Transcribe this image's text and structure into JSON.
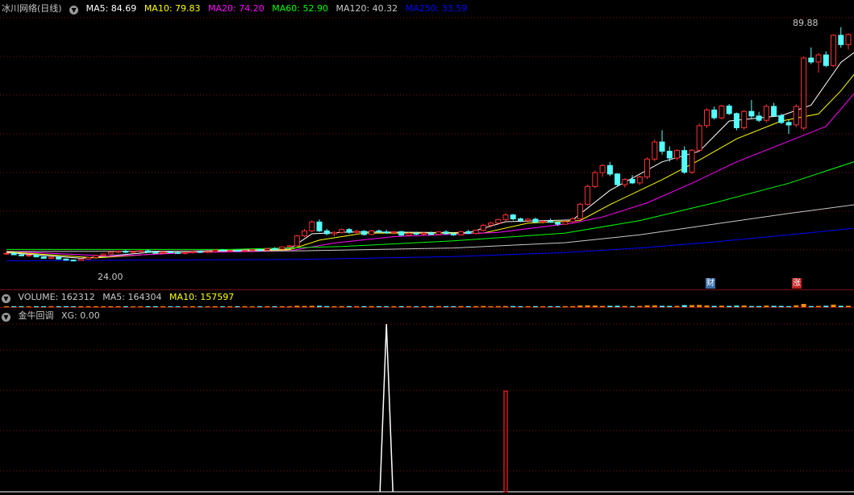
{
  "header": {
    "stock_title": "冰川网络(日线)",
    "ma_legend": [
      {
        "label": "MA5: 84.69",
        "color": "#ffffff"
      },
      {
        "label": "MA10: 79.83",
        "color": "#ffff00"
      },
      {
        "label": "MA20: 74.20",
        "color": "#ff00ff"
      },
      {
        "label": "MA60: 52.90",
        "color": "#00ff00"
      },
      {
        "label": "MA120: 40.32",
        "color": "#c8c8c8"
      },
      {
        "label": "MA250: 33.59",
        "color": "#0000ff"
      }
    ],
    "high_marker": "89.88",
    "low_marker": "24.00",
    "event_markers": [
      {
        "label": "财",
        "color": "#3a6ea5"
      },
      {
        "label": "涨",
        "color": "#c02020"
      }
    ]
  },
  "volume": {
    "title": "VOLUME: 162312",
    "ma5": "MA5: 164304",
    "ma10": "MA10: 157597"
  },
  "indicator": {
    "title": "金牛回调",
    "xg": "XG: 0.00"
  },
  "colors": {
    "up": "#ff3232",
    "down": "#54ffff",
    "grid": "#7a0f0f",
    "text": "#c8c8c8"
  },
  "chart_data": {
    "type": "candlestick",
    "price_range": [
      20,
      93
    ],
    "candles": [
      [
        26.2,
        26.5,
        25.9,
        26.3
      ],
      [
        26.3,
        26.4,
        25.8,
        25.9
      ],
      [
        25.9,
        26.1,
        25.5,
        25.6
      ],
      [
        25.6,
        25.9,
        25.3,
        25.8
      ],
      [
        25.8,
        25.9,
        25.2,
        25.3
      ],
      [
        25.3,
        25.5,
        24.8,
        24.9
      ],
      [
        24.9,
        25.3,
        24.7,
        25.2
      ],
      [
        25.2,
        25.3,
        24.6,
        24.7
      ],
      [
        24.7,
        24.9,
        24.2,
        24.4
      ],
      [
        24.4,
        24.6,
        24.0,
        24.3
      ],
      [
        24.3,
        24.8,
        24.2,
        24.7
      ],
      [
        24.7,
        25.2,
        24.6,
        25.1
      ],
      [
        25.1,
        25.9,
        25.0,
        25.7
      ],
      [
        25.7,
        26.3,
        25.5,
        26.1
      ],
      [
        26.1,
        26.8,
        25.9,
        26.6
      ],
      [
        26.6,
        27.1,
        26.2,
        26.9
      ],
      [
        26.9,
        27.3,
        26.4,
        26.6
      ],
      [
        26.6,
        27.0,
        26.3,
        26.8
      ],
      [
        26.8,
        27.2,
        26.5,
        27.0
      ],
      [
        27.0,
        27.3,
        26.5,
        26.6
      ],
      [
        26.6,
        26.9,
        26.2,
        26.4
      ],
      [
        26.4,
        26.8,
        26.1,
        26.7
      ],
      [
        26.7,
        27.0,
        26.3,
        26.5
      ],
      [
        26.5,
        26.8,
        26.1,
        26.3
      ],
      [
        26.3,
        26.6,
        26.0,
        26.5
      ],
      [
        26.5,
        26.9,
        26.2,
        26.8
      ],
      [
        26.8,
        27.1,
        26.4,
        26.6
      ],
      [
        26.6,
        26.9,
        26.3,
        26.8
      ],
      [
        26.8,
        27.4,
        26.6,
        27.2
      ],
      [
        27.2,
        27.5,
        26.8,
        27.0
      ],
      [
        27.0,
        27.3,
        26.7,
        27.1
      ],
      [
        27.1,
        27.4,
        26.8,
        26.9
      ],
      [
        26.9,
        27.2,
        26.7,
        27.1
      ],
      [
        27.1,
        27.5,
        26.9,
        27.3
      ],
      [
        27.3,
        27.6,
        27.0,
        27.2
      ],
      [
        27.2,
        27.8,
        27.0,
        27.6
      ],
      [
        27.6,
        28.0,
        27.3,
        27.5
      ],
      [
        27.5,
        28.3,
        27.4,
        28.1
      ],
      [
        28.1,
        28.6,
        27.9,
        28.4
      ],
      [
        28.4,
        31.5,
        28.2,
        31.2
      ],
      [
        31.2,
        33.2,
        30.8,
        32.6
      ],
      [
        32.6,
        35.6,
        32.2,
        35.1
      ],
      [
        35.1,
        35.8,
        32.3,
        32.6
      ],
      [
        32.6,
        33.2,
        31.4,
        31.8
      ],
      [
        31.8,
        32.5,
        31.1,
        32.2
      ],
      [
        32.2,
        33.3,
        31.9,
        33.0
      ],
      [
        33.0,
        33.4,
        31.8,
        32.2
      ],
      [
        32.2,
        32.9,
        31.6,
        32.5
      ],
      [
        32.5,
        32.8,
        31.3,
        31.6
      ],
      [
        31.6,
        32.9,
        31.4,
        32.6
      ],
      [
        32.6,
        33.0,
        31.9,
        32.3
      ],
      [
        32.3,
        32.9,
        31.8,
        32.1
      ],
      [
        32.1,
        32.6,
        31.6,
        32.4
      ],
      [
        32.4,
        32.6,
        31.2,
        31.4
      ],
      [
        31.4,
        32.2,
        31.1,
        31.9
      ],
      [
        31.9,
        32.4,
        31.4,
        31.7
      ],
      [
        31.7,
        32.3,
        31.2,
        32.0
      ],
      [
        32.0,
        32.4,
        31.4,
        31.6
      ],
      [
        31.6,
        32.6,
        31.4,
        32.3
      ],
      [
        32.3,
        32.8,
        31.6,
        31.8
      ],
      [
        31.8,
        32.2,
        31.2,
        31.5
      ],
      [
        31.5,
        32.6,
        31.3,
        32.4
      ],
      [
        32.4,
        32.9,
        31.7,
        31.9
      ],
      [
        31.9,
        33.0,
        31.6,
        32.8
      ],
      [
        32.8,
        34.6,
        32.5,
        34.2
      ],
      [
        34.2,
        35.2,
        33.6,
        34.8
      ],
      [
        34.8,
        36.1,
        34.3,
        35.8
      ],
      [
        35.8,
        37.6,
        35.2,
        37.1
      ],
      [
        37.1,
        37.4,
        35.6,
        36.0
      ],
      [
        36.0,
        36.3,
        35.1,
        35.5
      ],
      [
        35.5,
        36.2,
        34.9,
        35.9
      ],
      [
        35.9,
        36.3,
        34.8,
        35.1
      ],
      [
        35.1,
        35.6,
        34.6,
        35.3
      ],
      [
        35.3,
        36.1,
        34.9,
        35.0
      ],
      [
        35.0,
        35.3,
        34.0,
        34.5
      ],
      [
        34.5,
        35.6,
        34.3,
        35.2
      ],
      [
        35.2,
        36.4,
        34.9,
        36.0
      ],
      [
        36.0,
        40.5,
        35.8,
        40.1
      ],
      [
        40.1,
        45.6,
        39.8,
        45.1
      ],
      [
        45.1,
        49.6,
        44.6,
        49.0
      ],
      [
        49.0,
        51.4,
        47.8,
        51.0
      ],
      [
        51.0,
        52.0,
        48.0,
        48.6
      ],
      [
        48.6,
        48.9,
        45.2,
        45.6
      ],
      [
        45.6,
        47.4,
        44.8,
        47.1
      ],
      [
        47.1,
        48.3,
        45.8,
        46.1
      ],
      [
        46.1,
        48.2,
        45.5,
        47.8
      ],
      [
        47.8,
        53.3,
        47.2,
        52.8
      ],
      [
        52.8,
        58.3,
        52.2,
        57.6
      ],
      [
        57.6,
        60.9,
        54.1,
        55.0
      ],
      [
        55.0,
        56.4,
        52.1,
        53.1
      ],
      [
        53.1,
        55.6,
        52.4,
        55.2
      ],
      [
        55.2,
        56.4,
        48.6,
        49.1
      ],
      [
        49.1,
        55.6,
        48.6,
        55.3
      ],
      [
        55.3,
        62.8,
        54.8,
        62.2
      ],
      [
        62.2,
        67.1,
        61.5,
        66.6
      ],
      [
        66.6,
        67.6,
        63.9,
        64.4
      ],
      [
        64.4,
        68.1,
        63.9,
        67.7
      ],
      [
        67.7,
        68.3,
        65.2,
        65.6
      ],
      [
        65.6,
        65.9,
        60.9,
        61.6
      ],
      [
        61.6,
        66.6,
        61.1,
        66.2
      ],
      [
        66.2,
        69.4,
        64.1,
        64.9
      ],
      [
        64.9,
        66.1,
        63.2,
        63.7
      ],
      [
        63.7,
        68.2,
        63.1,
        67.6
      ],
      [
        67.6,
        68.6,
        64.6,
        65.0
      ],
      [
        65.0,
        65.6,
        62.6,
        63.1
      ],
      [
        63.1,
        63.8,
        59.9,
        62.4
      ],
      [
        62.4,
        68.2,
        61.8,
        67.6
      ],
      [
        61.5,
        81.6,
        60.9,
        81.2
      ],
      [
        81.2,
        84.2,
        79.5,
        80.1
      ],
      [
        80.1,
        82.6,
        77.1,
        82.1
      ],
      [
        82.1,
        83.1,
        78.6,
        79.1
      ],
      [
        79.1,
        87.9,
        78.7,
        87.6
      ],
      [
        87.6,
        89.9,
        84.1,
        85.0
      ],
      [
        85.0,
        88.2,
        83.6,
        87.8
      ]
    ],
    "ma_lines": {
      "MA5": [
        [
          0,
          26.5
        ],
        [
          10,
          24.9
        ],
        [
          20,
          26.7
        ],
        [
          38,
          27.5
        ],
        [
          41,
          31.8
        ],
        [
          46,
          32.3
        ],
        [
          62,
          32.1
        ],
        [
          67,
          35.2
        ],
        [
          76,
          35.7
        ],
        [
          81,
          44.0
        ],
        [
          88,
          52.0
        ],
        [
          93,
          55.0
        ],
        [
          97,
          63.5
        ],
        [
          104,
          65.0
        ],
        [
          108,
          68.0
        ],
        [
          112,
          80.0
        ],
        [
          115,
          84.7
        ]
      ],
      "MA10": [
        [
          0,
          26.7
        ],
        [
          12,
          25.0
        ],
        [
          22,
          26.4
        ],
        [
          38,
          27.3
        ],
        [
          42,
          30.0
        ],
        [
          48,
          32.0
        ],
        [
          64,
          32.0
        ],
        [
          70,
          34.8
        ],
        [
          77,
          35.5
        ],
        [
          81,
          40.0
        ],
        [
          88,
          47.0
        ],
        [
          93,
          52.5
        ],
        [
          98,
          58.5
        ],
        [
          104,
          63.5
        ],
        [
          109,
          65.5
        ],
        [
          112,
          72.0
        ],
        [
          115,
          79.8
        ]
      ],
      "MA20": [
        [
          0,
          26.9
        ],
        [
          14,
          25.5
        ],
        [
          25,
          26.5
        ],
        [
          38,
          27.0
        ],
        [
          44,
          29.2
        ],
        [
          52,
          31.0
        ],
        [
          66,
          32.2
        ],
        [
          76,
          34.8
        ],
        [
          80,
          36.5
        ],
        [
          86,
          40.5
        ],
        [
          92,
          46.0
        ],
        [
          98,
          52.0
        ],
        [
          104,
          57.0
        ],
        [
          110,
          62.0
        ],
        [
          115,
          74.2
        ]
      ],
      "MA60": [
        [
          0,
          27.4
        ],
        [
          30,
          27.4
        ],
        [
          45,
          28.2
        ],
        [
          60,
          29.8
        ],
        [
          75,
          32.0
        ],
        [
          85,
          35.5
        ],
        [
          95,
          40.5
        ],
        [
          105,
          46.0
        ],
        [
          115,
          52.9
        ]
      ],
      "MA120": [
        [
          0,
          26.8
        ],
        [
          40,
          27.0
        ],
        [
          60,
          27.8
        ],
        [
          75,
          29.3
        ],
        [
          85,
          31.5
        ],
        [
          95,
          34.5
        ],
        [
          105,
          37.5
        ],
        [
          115,
          40.3
        ]
      ],
      "MA250": [
        [
          0,
          24.2
        ],
        [
          40,
          24.6
        ],
        [
          60,
          25.4
        ],
        [
          75,
          26.5
        ],
        [
          85,
          27.8
        ],
        [
          95,
          29.5
        ],
        [
          105,
          31.5
        ],
        [
          115,
          33.6
        ]
      ]
    },
    "indicator_signals": [
      {
        "index": 51,
        "type": "spike",
        "value": 1.0
      },
      {
        "index": 67,
        "type": "bar",
        "value": 0.6
      }
    ],
    "indicator_range": [
      0,
      1
    ]
  }
}
